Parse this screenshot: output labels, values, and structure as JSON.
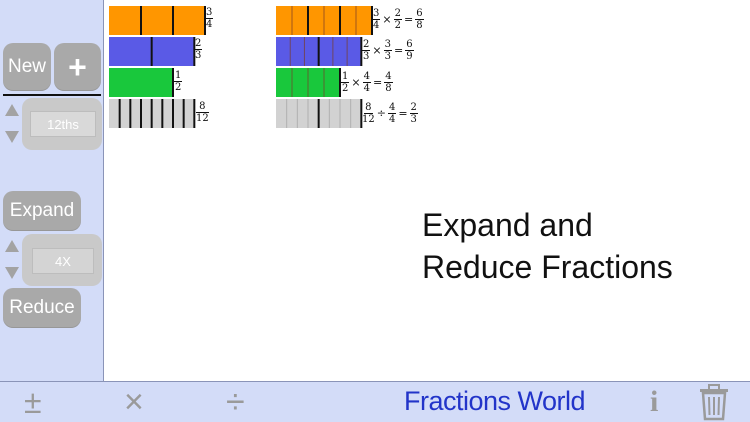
{
  "sidebar": {
    "new_label": "New",
    "plus_label": "+",
    "denominator_value": "12ths",
    "expand_label": "Expand",
    "factor_value": "4X",
    "reduce_label": "Reduce"
  },
  "headline": {
    "line1": "Expand and",
    "line2": "Reduce Fractions"
  },
  "bottombar": {
    "plus_minus_icon": "±",
    "times_icon": "×",
    "divide_icon": "÷",
    "title": "Fractions World",
    "info_icon": "i",
    "trash_icon": "trash-icon"
  },
  "colors": {
    "orange": "#ff9600",
    "blue": "#5a5ae6",
    "green": "#19c83c",
    "gray": "#d2d2d2",
    "title_blue": "#2234c9"
  },
  "left_bars": [
    {
      "numerator": "3",
      "denominator": "4",
      "color": "#ff9600",
      "parts": 4,
      "filled": 3
    },
    {
      "numerator": "2",
      "denominator": "3",
      "color": "#5a5ae6",
      "parts": 3,
      "filled": 2
    },
    {
      "numerator": "1",
      "denominator": "2",
      "color": "#19c83c",
      "parts": 2,
      "filled": 1
    },
    {
      "numerator": "8",
      "denominator": "12",
      "color": "#d2d2d2",
      "parts": 12,
      "filled": 8
    }
  ],
  "right_bars": [
    {
      "a_num": "3",
      "a_den": "4",
      "op": "×",
      "b_num": "2",
      "b_den": "2",
      "r_num": "6",
      "r_den": "8",
      "color": "#ff9600",
      "parts": 8,
      "filled": 6,
      "major": 4
    },
    {
      "a_num": "2",
      "a_den": "3",
      "op": "×",
      "b_num": "3",
      "b_den": "3",
      "r_num": "6",
      "r_den": "9",
      "color": "#5a5ae6",
      "parts": 9,
      "filled": 6,
      "major": 3
    },
    {
      "a_num": "1",
      "a_den": "2",
      "op": "×",
      "b_num": "4",
      "b_den": "4",
      "r_num": "4",
      "r_den": "8",
      "color": "#19c83c",
      "parts": 8,
      "filled": 4,
      "major": 2
    },
    {
      "a_num": "8",
      "a_den": "12",
      "op": "÷",
      "b_num": "4",
      "b_den": "4",
      "r_num": "2",
      "r_den": "3",
      "color": "#d2d2d2",
      "parts": 12,
      "filled": 8,
      "major": 3
    }
  ]
}
